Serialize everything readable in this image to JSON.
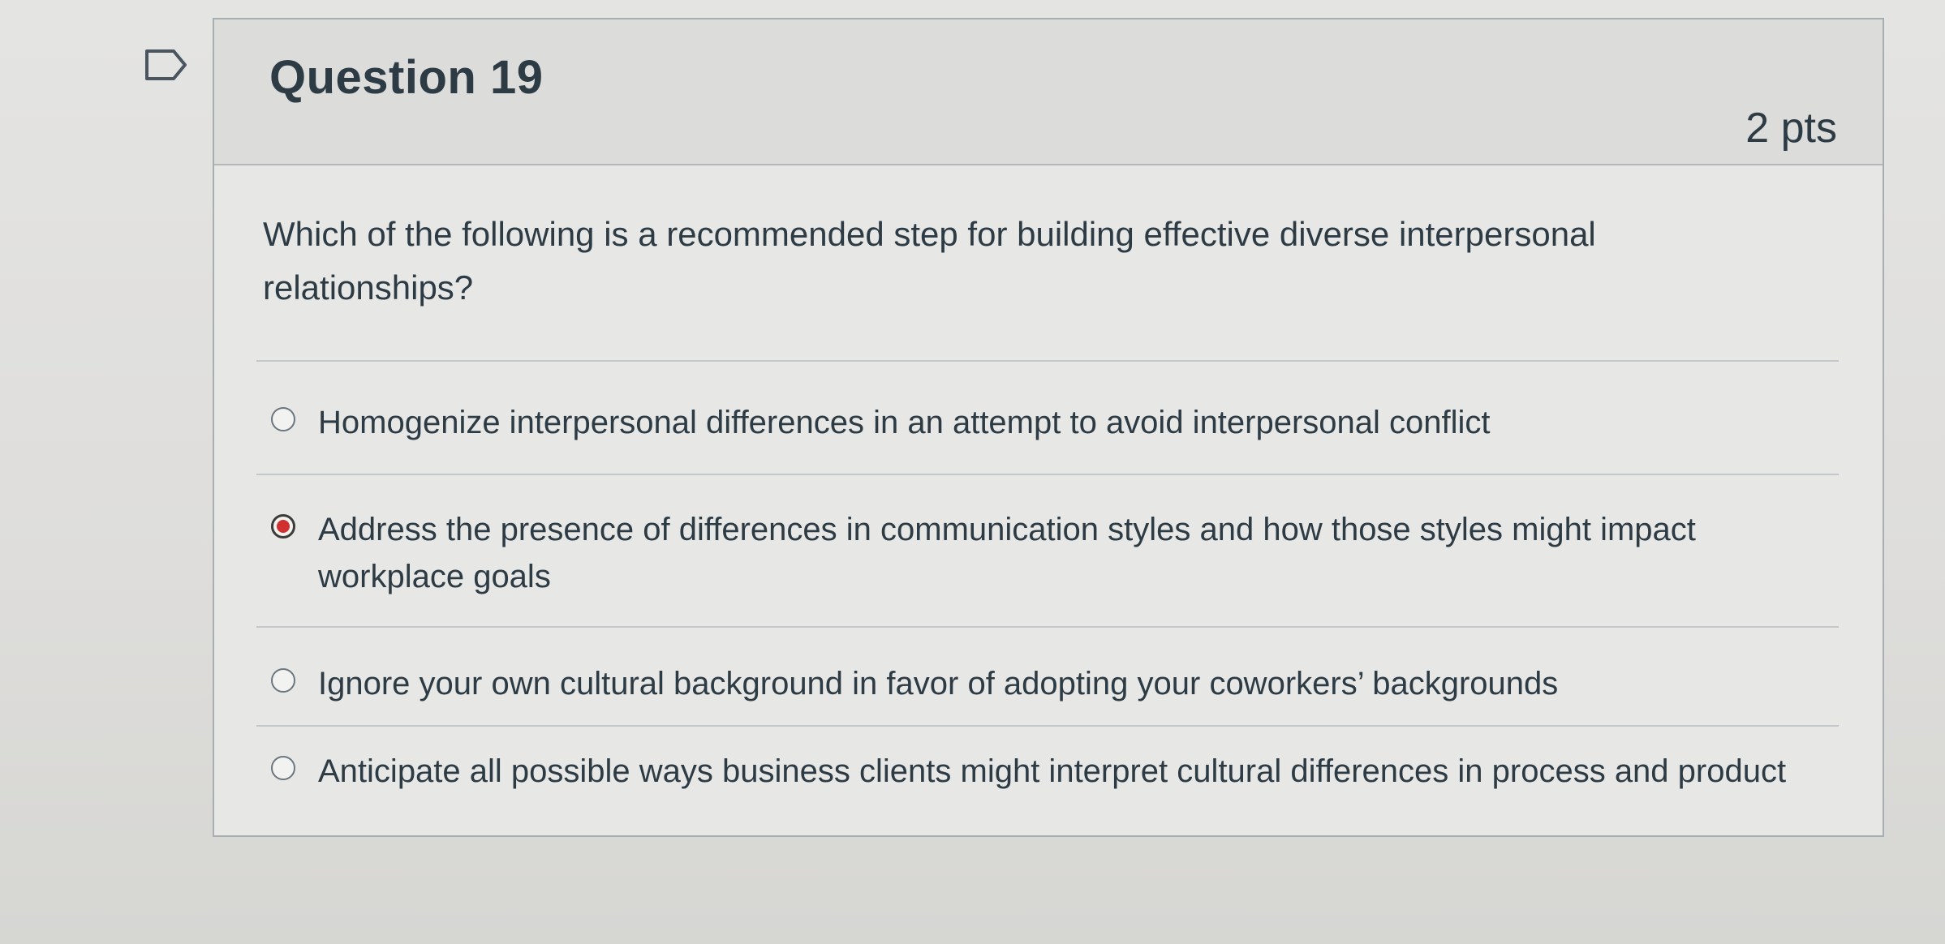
{
  "question": {
    "title": "Question 19",
    "points": "2 pts",
    "text": "Which of the following is a recommended step for building effective diverse interpersonal relationships?"
  },
  "answers": [
    {
      "label": "Homogenize interpersonal differences in an attempt to avoid interpersonal conflict",
      "selected": false
    },
    {
      "label": "Address the presence of differences in communication styles and how those styles might impact workplace goals",
      "selected": true
    },
    {
      "label": "Ignore your own cultural background in favor of adopting your coworkers’ backgrounds",
      "selected": false
    },
    {
      "label": "Anticipate all possible ways business clients might interpret cultural differences in process and product",
      "selected": false
    }
  ],
  "icons": {
    "flag": "flag-question-icon"
  },
  "colors": {
    "selected_radio": "#d0302f",
    "text": "#2d3b45"
  }
}
